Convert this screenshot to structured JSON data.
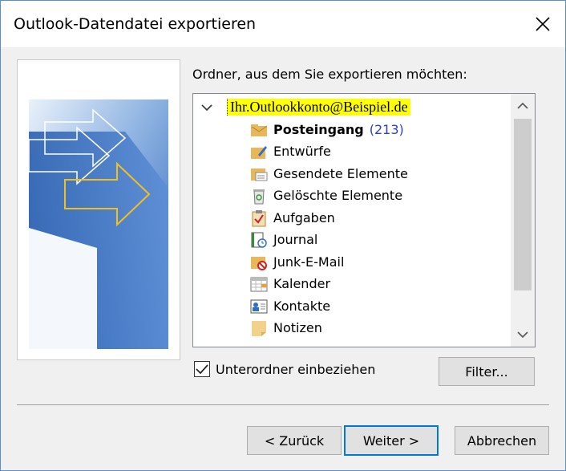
{
  "window": {
    "title": "Outlook-Datendatei exportieren",
    "close_icon": "close-icon"
  },
  "folder_prompt": "Ordner, aus dem Sie exportieren möchten:",
  "tree": {
    "account": "Ihr.Outlookkonto@Beispiel.de",
    "items": [
      {
        "label": "Posteingang",
        "count": "(213)",
        "icon": "inbox-icon",
        "bold": true
      },
      {
        "label": "Entwürfe",
        "count": "",
        "icon": "drafts-icon",
        "bold": false
      },
      {
        "label": "Gesendete Elemente",
        "count": "",
        "icon": "sent-items-icon",
        "bold": false
      },
      {
        "label": "Gelöschte Elemente",
        "count": "",
        "icon": "deleted-items-icon",
        "bold": false
      },
      {
        "label": "Aufgaben",
        "count": "",
        "icon": "tasks-icon",
        "bold": false
      },
      {
        "label": "Journal",
        "count": "",
        "icon": "journal-icon",
        "bold": false
      },
      {
        "label": "Junk-E-Mail",
        "count": "",
        "icon": "junk-mail-icon",
        "bold": false
      },
      {
        "label": "Kalender",
        "count": "",
        "icon": "calendar-icon",
        "bold": false
      },
      {
        "label": "Kontakte",
        "count": "",
        "icon": "contacts-icon",
        "bold": false
      },
      {
        "label": "Notizen",
        "count": "",
        "icon": "notes-icon",
        "bold": false
      }
    ]
  },
  "include_subfolders": {
    "label": "Unterordner einbeziehen",
    "checked": true
  },
  "buttons": {
    "filter": "Filter...",
    "back": "< Zurück",
    "next": "Weiter >",
    "cancel": "Abbrechen"
  },
  "colors": {
    "highlight": "#ffff00",
    "count": "#2940c8",
    "primary_border": "#0078d7"
  }
}
